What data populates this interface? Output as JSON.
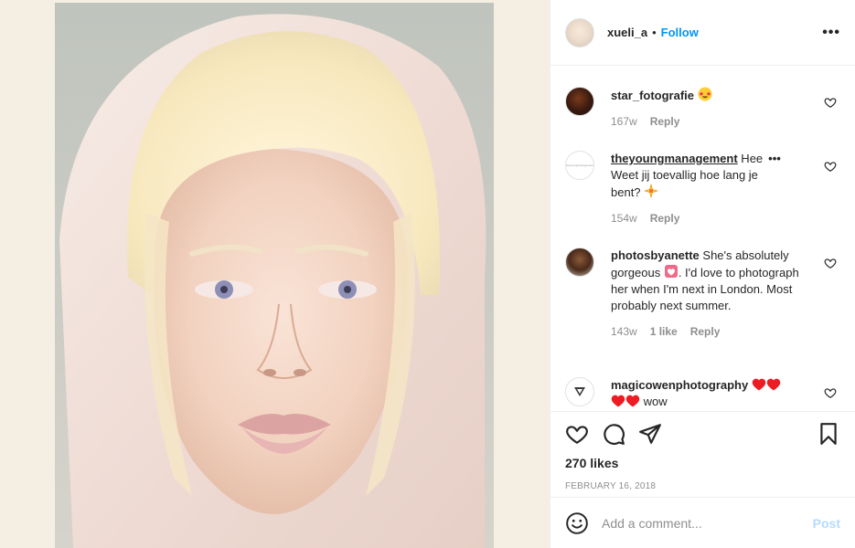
{
  "header": {
    "username": "xueli_a",
    "separator": "•",
    "follow_label": "Follow",
    "more_icon": "more-horizontal-icon"
  },
  "comments": [
    {
      "username": "star_fotografie",
      "text": " ",
      "emoji": "star-struck",
      "time": "167w",
      "likes": "",
      "reply": "Reply"
    },
    {
      "username": "theyoungmanagement",
      "text": " Hee",
      "text2": "Weet jij toevallig hoe lang je",
      "text3": "bent? ",
      "emoji": "sparkle",
      "avatar_label": "theyoungmanagement",
      "time": "154w",
      "likes": "",
      "reply": "Reply"
    },
    {
      "username": "photosbyanette",
      "text": " She's absolutely gorgeous ",
      "text_after": ". I'd love to photograph her when I'm next in London. Most probably next summer.",
      "emoji": "heart-face",
      "time": "143w",
      "likes": "1 like",
      "reply": "Reply"
    },
    {
      "username": "magicowenphotography",
      "text_after": " wow",
      "emoji": "red-hearts"
    }
  ],
  "actions": {
    "likes": "270 likes",
    "date": "FEBRUARY 16, 2018"
  },
  "add_comment": {
    "placeholder": "Add a comment...",
    "post_label": "Post"
  },
  "colors": {
    "accent": "#0095f6",
    "post_disabled": "#b3dbff",
    "heart_red": "#ed4956",
    "background": "#f5efe3"
  }
}
